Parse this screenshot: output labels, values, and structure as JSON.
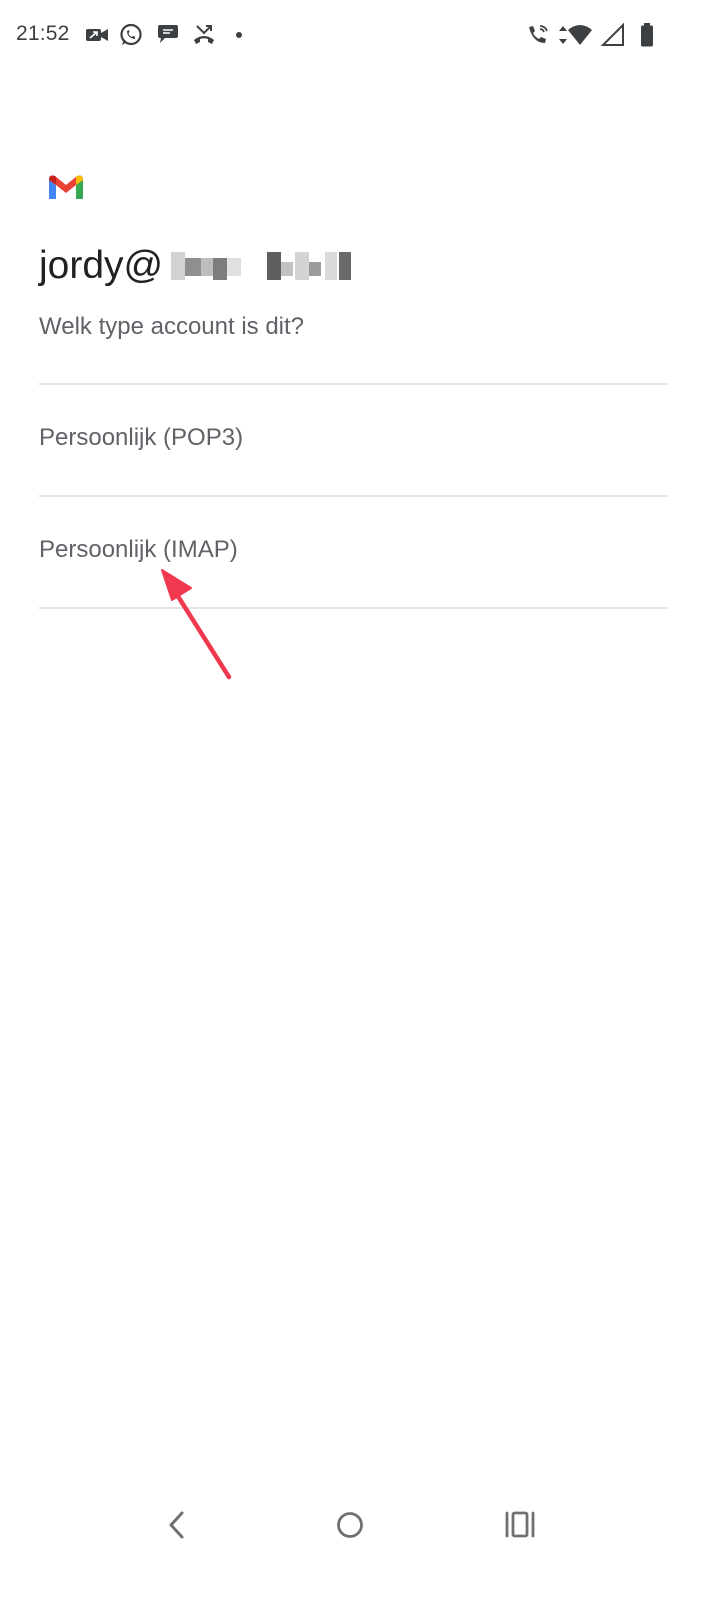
{
  "status_bar": {
    "time": "21:52",
    "left_icons": [
      "video-call-icon",
      "whatsapp-icon",
      "chat-bubble-icon",
      "missed-call-icon",
      "notification-dot-icon"
    ],
    "right_icons": [
      "wifi-calling-icon",
      "wifi-icon",
      "cell-signal-icon",
      "battery-icon"
    ]
  },
  "header": {
    "app_icon": "gmail-logo-icon",
    "email_prefix": "jordy@",
    "question": "Welk type account is dit?"
  },
  "options": [
    {
      "label": "Persoonlijk (POP3)"
    },
    {
      "label": "Persoonlijk (IMAP)"
    }
  ],
  "annotation": {
    "icon": "red-arrow-icon",
    "color": "#f0384f"
  },
  "nav_bar": {
    "icons": [
      "back-icon",
      "home-icon",
      "recents-icon"
    ]
  },
  "colors": {
    "primary_text": "#202124",
    "secondary_text": "#5f6368",
    "divider": "#e4e4e4",
    "gmail_red": "#ea4335",
    "gmail_blue": "#4285f4",
    "gmail_green": "#34a853",
    "gmail_yellow": "#fbbc04"
  }
}
